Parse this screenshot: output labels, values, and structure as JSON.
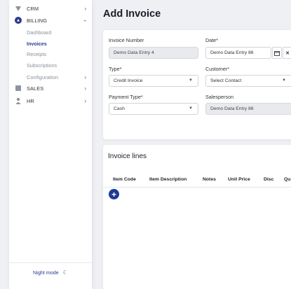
{
  "sidebar": {
    "top_items": [
      {
        "label": "CRM"
      },
      {
        "label": "BILLING"
      }
    ],
    "billing_subitems": [
      "Dashboard",
      "Invoices",
      "Receipts",
      "Subscriptions",
      "Configuration"
    ],
    "bottom_items": [
      {
        "label": "SALES"
      },
      {
        "label": "HR"
      }
    ],
    "night_mode_label": "Night mode"
  },
  "page": {
    "title": "Add Invoice"
  },
  "form": {
    "invoice_number": {
      "label": "Invoice Number",
      "value": "Demo Data Entry 4"
    },
    "date": {
      "label": "Date*",
      "value": "Demo Data Entry 86"
    },
    "type": {
      "label": "Type*",
      "value": "Credit Invoice"
    },
    "customer": {
      "label": "Customer*",
      "value": "Select Contact"
    },
    "payment_type": {
      "label": "Payment Type*",
      "value": "Cash"
    },
    "salesperson": {
      "label": "Salesperson",
      "value": "Demo Data Entry 86"
    }
  },
  "invoice_lines": {
    "title": "Invoice lines",
    "columns": [
      "Item Code",
      "Item Description",
      "Notes",
      "Unit Price",
      "Disc",
      "Qu"
    ]
  },
  "colors": {
    "accent": "#2b3a8c",
    "add_button": "#1f3a93"
  }
}
